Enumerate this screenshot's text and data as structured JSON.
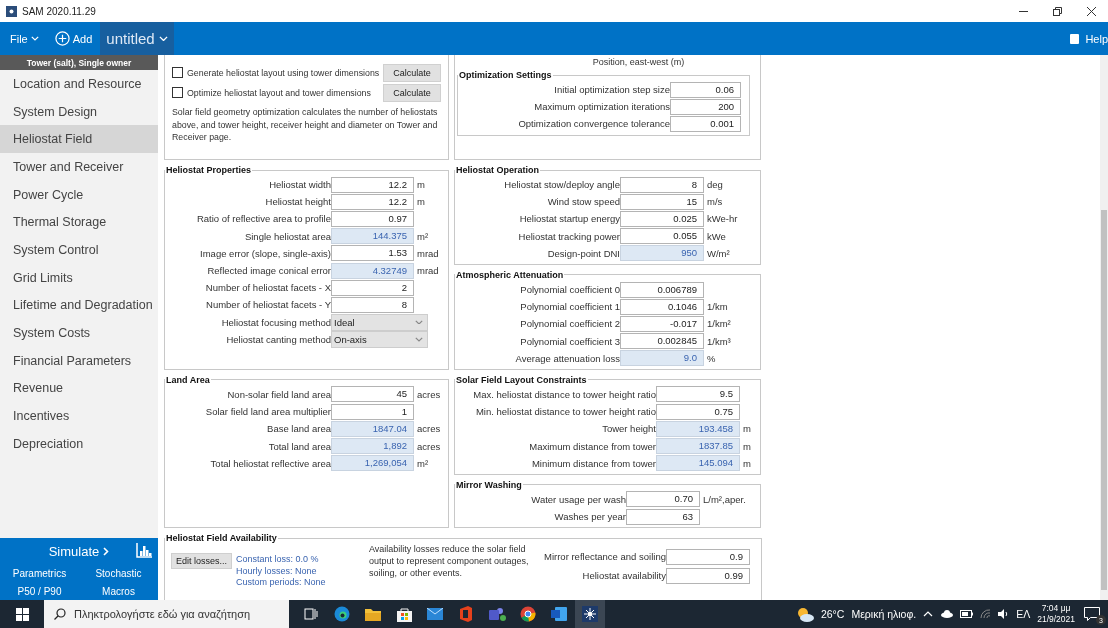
{
  "window": {
    "title": "SAM 2020.11.29"
  },
  "menu_bar": {
    "file": "File",
    "add": "Add",
    "case": "untitled",
    "help": "Help"
  },
  "sidebar": {
    "header": "Tower (salt), Single owner",
    "items": [
      {
        "label": "Location and Resource",
        "selected": false
      },
      {
        "label": "System Design",
        "selected": false
      },
      {
        "label": "Heliostat Field",
        "selected": true
      },
      {
        "label": "Tower and Receiver",
        "selected": false
      },
      {
        "label": "Power Cycle",
        "selected": false
      },
      {
        "label": "Thermal Storage",
        "selected": false
      },
      {
        "label": "System Control",
        "selected": false
      },
      {
        "label": "Grid Limits",
        "selected": false
      },
      {
        "label": "Lifetime and Degradation",
        "selected": false
      },
      {
        "label": "System Costs",
        "selected": false
      },
      {
        "label": "Financial Parameters",
        "selected": false
      },
      {
        "label": "Revenue",
        "selected": false
      },
      {
        "label": "Incentives",
        "selected": false
      },
      {
        "label": "Depreciation",
        "selected": false
      }
    ]
  },
  "simulate": {
    "label": "Simulate",
    "links": [
      "Parametrics",
      "Stochastic",
      "P50 / P90",
      "Macros"
    ]
  },
  "layout_options": {
    "checkboxes": [
      {
        "label": "Generate heliostat layout using tower dimensions",
        "checked": false,
        "button": "Calculate"
      },
      {
        "label": "Optimize heliostat layout and tower dimensions",
        "checked": false,
        "button": "Calculate"
      }
    ],
    "note": "Solar field geometry optimization calculates the number of heliostats above, and tower height, receiver height and diameter on Tower and Receiver page."
  },
  "layout_plot": {
    "axis_label": "Position, east-west (m)"
  },
  "optimization_settings": {
    "title": "Optimization Settings",
    "rows": [
      {
        "label": "Initial optimization step size",
        "value": "0.06",
        "kind": "input"
      },
      {
        "label": "Maximum optimization iterations",
        "value": "200",
        "kind": "input"
      },
      {
        "label": "Optimization convergence tolerance",
        "value": "0.001",
        "kind": "input"
      }
    ]
  },
  "heliostat_properties": {
    "title": "Heliostat Properties",
    "rows": [
      {
        "label": "Heliostat width",
        "value": "12.2",
        "unit": "m",
        "kind": "input"
      },
      {
        "label": "Heliostat height",
        "value": "12.2",
        "unit": "m",
        "kind": "input"
      },
      {
        "label": "Ratio of reflective area to profile",
        "value": "0.97",
        "kind": "input"
      },
      {
        "label": "Single heliostat area",
        "value": "144.375",
        "unit": "m²",
        "kind": "computed"
      },
      {
        "label": "Image error (slope, single-axis)",
        "value": "1.53",
        "unit": "mrad",
        "kind": "input"
      },
      {
        "label": "Reflected image conical error",
        "value": "4.32749",
        "unit": "mrad",
        "kind": "computed"
      },
      {
        "label": "Number of heliostat facets - X",
        "value": "2",
        "kind": "input"
      },
      {
        "label": "Number of heliostat facets - Y",
        "value": "8",
        "kind": "input"
      },
      {
        "label": "Heliostat focusing method",
        "value": "Ideal",
        "kind": "dropdown"
      },
      {
        "label": "Heliostat canting method",
        "value": "On-axis",
        "kind": "dropdown"
      }
    ]
  },
  "heliostat_operation": {
    "title": "Heliostat Operation",
    "rows": [
      {
        "label": "Heliostat stow/deploy angle",
        "value": "8",
        "unit": "deg",
        "kind": "input"
      },
      {
        "label": "Wind stow speed",
        "value": "15",
        "unit": "m/s",
        "kind": "input"
      },
      {
        "label": "Heliostat startup energy",
        "value": "0.025",
        "unit": "kWe-hr",
        "kind": "input"
      },
      {
        "label": "Heliostat tracking power",
        "value": "0.055",
        "unit": "kWe",
        "kind": "input"
      },
      {
        "label": "Design-point DNI",
        "value": "950",
        "unit": "W/m²",
        "kind": "computed"
      }
    ]
  },
  "atmospheric_attenuation": {
    "title": "Atmospheric Attenuation",
    "rows": [
      {
        "label": "Polynomial coefficient 0",
        "value": "0.006789",
        "kind": "input"
      },
      {
        "label": "Polynomial coefficient 1",
        "value": "0.1046",
        "unit": "1/km",
        "kind": "input"
      },
      {
        "label": "Polynomial coefficient 2",
        "value": "-0.017",
        "unit": "1/km²",
        "kind": "input"
      },
      {
        "label": "Polynomial coefficient 3",
        "value": "0.002845",
        "unit": "1/km³",
        "kind": "input"
      },
      {
        "label": "Average attenuation loss",
        "value": "9.0",
        "unit": "%",
        "kind": "computed"
      }
    ]
  },
  "land_area": {
    "title": "Land Area",
    "rows": [
      {
        "label": "Non-solar field land area",
        "value": "45",
        "unit": "acres",
        "kind": "input"
      },
      {
        "label": "Solar field land area multiplier",
        "value": "1",
        "kind": "input"
      },
      {
        "label": "Base land area",
        "value": "1847.04",
        "unit": "acres",
        "kind": "computed"
      },
      {
        "label": "Total land area",
        "value": "1,892",
        "unit": "acres",
        "kind": "computed"
      },
      {
        "label": "Total heliostat reflective area",
        "value": "1,269,054",
        "unit": "m²",
        "kind": "computed"
      }
    ]
  },
  "solar_field_layout_constraints": {
    "title": "Solar Field Layout Constraints",
    "rows": [
      {
        "label": "Max. heliostat distance to tower height ratio",
        "value": "9.5",
        "kind": "input"
      },
      {
        "label": "Min. heliostat distance to tower height ratio",
        "value": "0.75",
        "kind": "input"
      },
      {
        "label": "Tower height",
        "value": "193.458",
        "unit": "m",
        "kind": "computed"
      },
      {
        "label": "Maximum distance from tower",
        "value": "1837.85",
        "unit": "m",
        "kind": "computed"
      },
      {
        "label": "Minimum distance from tower",
        "value": "145.094",
        "unit": "m",
        "kind": "computed"
      }
    ]
  },
  "mirror_washing": {
    "title": "Mirror Washing",
    "rows": [
      {
        "label": "Water usage per wash",
        "value": "0.70",
        "unit": "L/m²,aper.",
        "kind": "input"
      },
      {
        "label": "Washes per year",
        "value": "63",
        "kind": "input"
      }
    ]
  },
  "heliostat_field_availability": {
    "title": "Heliostat Field Availability",
    "button": "Edit losses...",
    "losses": [
      "Constant loss: 0.0 %",
      "Hourly losses: None",
      "Custom periods: None"
    ],
    "note": "Availability losses reduce the solar field output to represent component outages, soiling, or other events.",
    "rows": [
      {
        "label": "Mirror reflectance and soiling",
        "value": "0.9",
        "kind": "input"
      },
      {
        "label": "Heliostat availability",
        "value": "0.99",
        "kind": "input"
      }
    ]
  },
  "taskbar": {
    "search_placeholder": "Πληκτρολογήστε εδώ για αναζήτηση",
    "temperature": "26°C",
    "weather": "Μερική ηλιοφ.",
    "language": "ΕΛ",
    "time": "7:04 μμ",
    "date": "21/9/2021",
    "notifications": "3"
  }
}
